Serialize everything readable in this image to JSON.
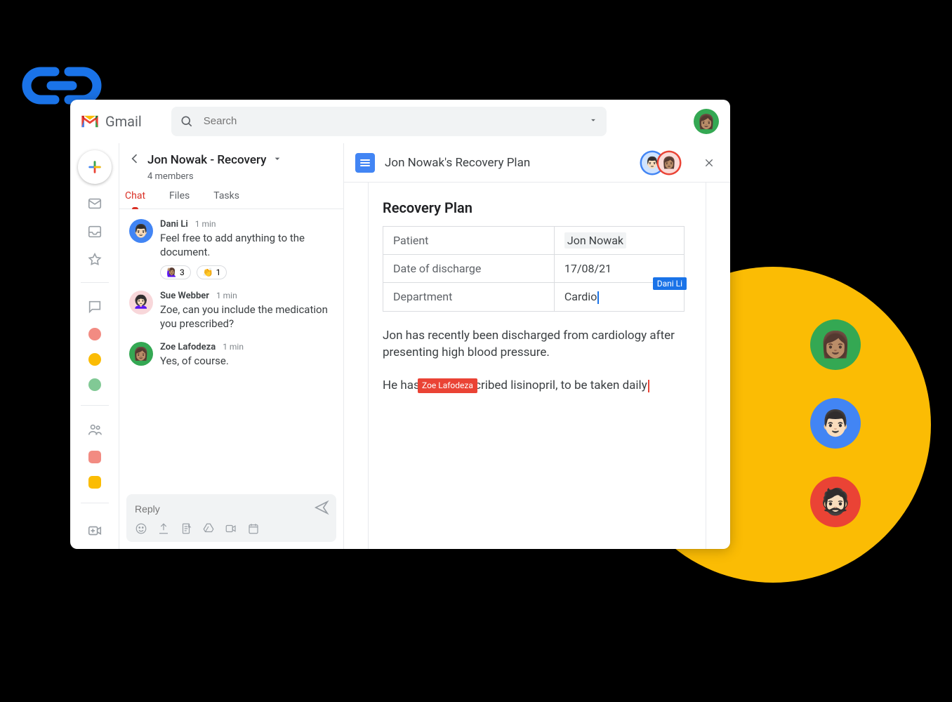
{
  "header": {
    "product": "Gmail",
    "search_placeholder": "Search"
  },
  "chat": {
    "title": "Jon Nowak - Recovery",
    "subtitle": "4 members",
    "tabs": {
      "chat": "Chat",
      "files": "Files",
      "tasks": "Tasks"
    },
    "messages": [
      {
        "author": "Dani Li",
        "time": "1 min",
        "text": "Feel free to add anything to the document.",
        "reactions": [
          {
            "emoji": "🙋🏽‍♀️",
            "count": "3"
          },
          {
            "emoji": "👏",
            "count": "1"
          }
        ]
      },
      {
        "author": "Sue Webber",
        "time": "1 min",
        "text": "Zoe, can you include the medication you prescribed?"
      },
      {
        "author": "Zoe Lafodeza",
        "time": "1 min",
        "text": "Yes, of course."
      }
    ],
    "reply_placeholder": "Reply"
  },
  "doc": {
    "title": "Jon Nowak's Recovery Plan",
    "heading": "Recovery Plan",
    "collaborators": [
      "Dani Li",
      "Zoe Lafodeza"
    ],
    "table": {
      "rows": [
        {
          "label": "Patient",
          "value": "Jon Nowak",
          "highlight": true
        },
        {
          "label": "Date of discharge",
          "value": "17/08/21"
        },
        {
          "label": "Department",
          "value": "Cardio",
          "cursor": "Dani Li"
        }
      ]
    },
    "para1": "Jon has recently been discharged from cardiology after presenting high blood pressure.",
    "para2_pre": "He has been prescribed lisinopril, to be taken daily",
    "para2_cursor": "Zoe Lafodeza"
  }
}
